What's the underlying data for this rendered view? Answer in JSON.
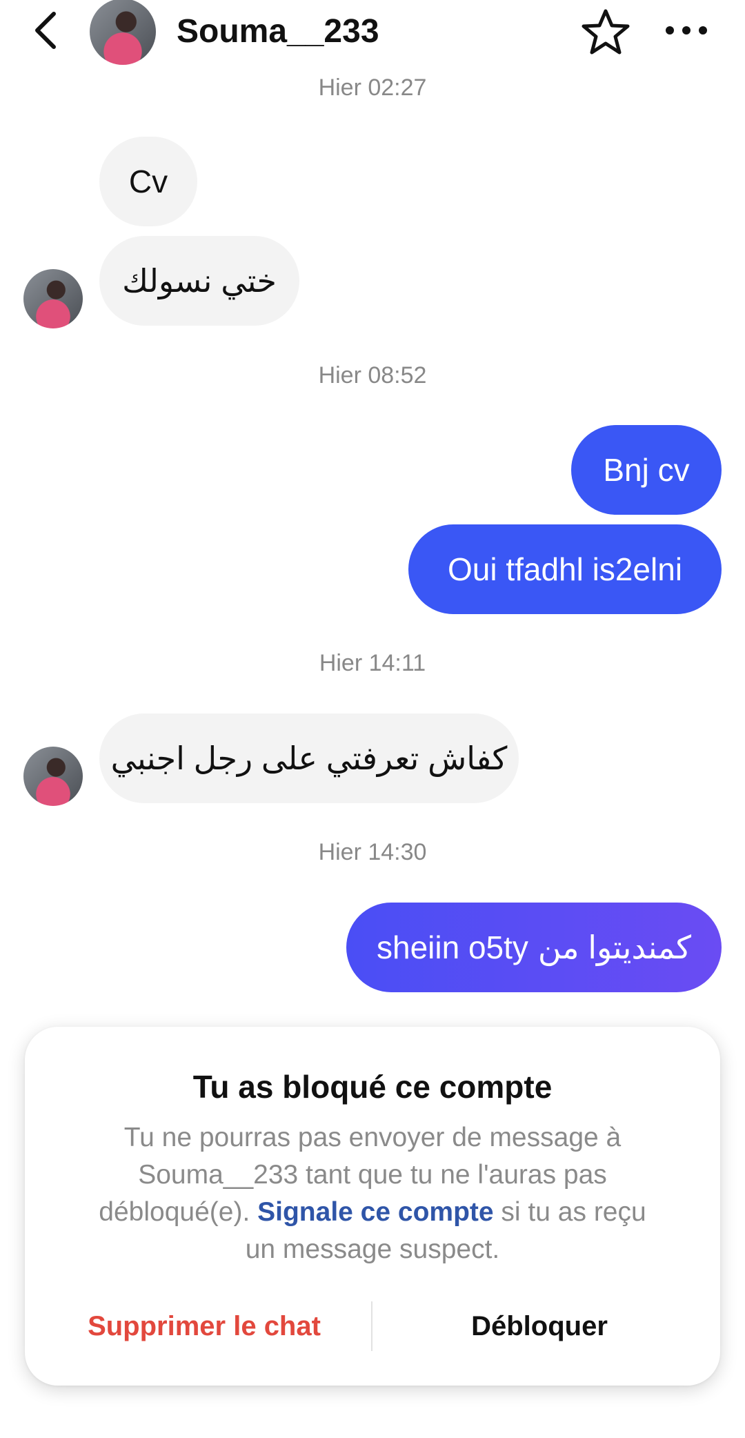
{
  "header": {
    "username": "Souma__233",
    "back_icon": "chevron-left-icon",
    "star_icon": "star-outline-icon",
    "more_icon": "more-horizontal-icon"
  },
  "conversation": {
    "timestamps": [
      "Hier 02:27",
      "Hier 08:52",
      "Hier 14:11",
      "Hier 14:30"
    ],
    "messages": [
      {
        "from": "contact",
        "text": "Cv"
      },
      {
        "from": "contact",
        "text": "ختي نسولك"
      },
      {
        "from": "me",
        "text": "Bnj cv"
      },
      {
        "from": "me",
        "text": "Oui tfadhl is2elni"
      },
      {
        "from": "contact",
        "text": "كفاش تعرفتي على رجل اجنبي"
      },
      {
        "from": "me",
        "text_latin": "sheiin o5ty",
        "text_arabic": "كمنديتوا من"
      }
    ]
  },
  "blocked_notice": {
    "title": "Tu as bloqué ce compte",
    "desc_before": "Tu ne pourras pas envoyer de message à Souma__233 tant que tu ne l'auras pas débloqué(e). ",
    "report_link": "Signale ce compte",
    "desc_after": " si tu as reçu un message suspect.",
    "delete_label": "Supprimer le chat",
    "unblock_label": "Débloquer"
  },
  "colors": {
    "outgoing_bubble": "#3a57f5",
    "incoming_bubble": "#f3f3f3",
    "delete_red": "#e2483d",
    "link_blue": "#2f55a8"
  }
}
